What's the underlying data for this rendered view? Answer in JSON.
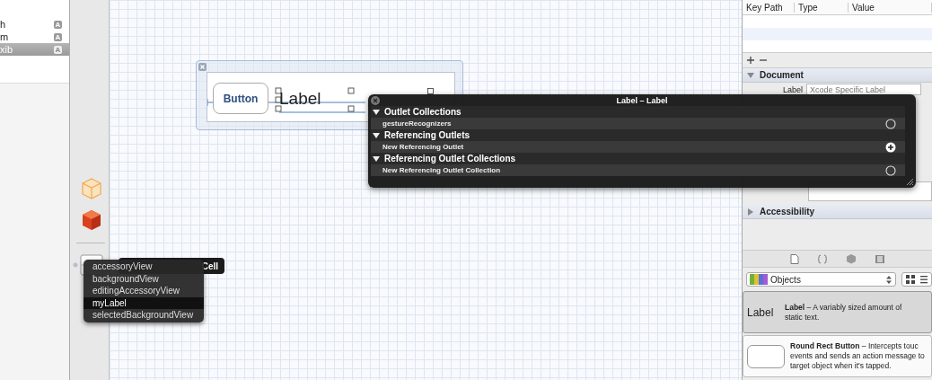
{
  "navigator": {
    "items": [
      {
        "label": "h",
        "badge": "A",
        "selected": false
      },
      {
        "label": "m",
        "badge": "A",
        "selected": false
      },
      {
        "label": "xib",
        "badge": "A",
        "selected": true
      }
    ]
  },
  "canvas": {
    "cell": {
      "button": "Button",
      "label": "Label"
    }
  },
  "connections_panel": {
    "title": "Label – Label",
    "sections": [
      {
        "title": "Outlet Collections",
        "expanded": true,
        "items": [
          {
            "label": "gestureRecognizers",
            "kind": "empty"
          }
        ]
      },
      {
        "title": "Referencing Outlets",
        "expanded": true,
        "items": [
          {
            "label": "New Referencing Outlet",
            "kind": "add"
          }
        ]
      },
      {
        "title": "Referencing Outlet Collections",
        "expanded": true,
        "items": [
          {
            "label": "New Referencing Outlet Collection",
            "kind": "empty"
          }
        ]
      }
    ]
  },
  "dock": {
    "tooltip": "Cell",
    "menu": [
      {
        "label": "accessoryView",
        "selected": false
      },
      {
        "label": "backgroundView",
        "selected": false
      },
      {
        "label": "editingAccessoryView",
        "selected": false
      },
      {
        "label": "myLabel",
        "selected": true
      },
      {
        "label": "selectedBackgroundView",
        "selected": false
      }
    ]
  },
  "inspector": {
    "table": {
      "columns": [
        "Key Path",
        "Type",
        "Value"
      ]
    },
    "sections": [
      {
        "title": "Document",
        "expanded": true,
        "field": {
          "label": "Label",
          "placeholder": "Xcode Specific Label"
        }
      },
      {
        "title": "Accessibility",
        "expanded": false
      }
    ]
  },
  "library": {
    "popup": "Objects",
    "items": [
      {
        "kind": "label",
        "preview": "Label",
        "selected": true,
        "lines": [
          "**Label** – A variably sized amount of",
          "static text."
        ]
      },
      {
        "kind": "button",
        "selected": false,
        "lines": [
          "**Round Rect Button** – Intercepts touc",
          "events and sends an action message to",
          "target object when it's tapped."
        ]
      }
    ]
  }
}
